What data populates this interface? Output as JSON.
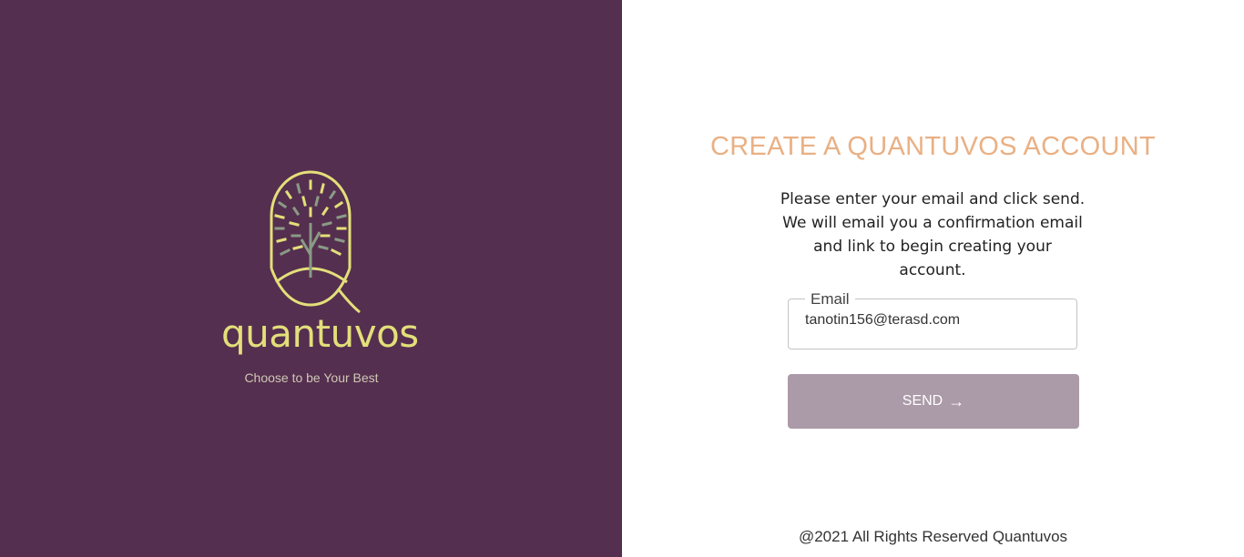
{
  "brand": {
    "name": "quantuvos",
    "tagline": "Choose to be Your Best",
    "colors": {
      "panel_bg": "#552f4f",
      "logo": "#e3df7a",
      "trunk": "#8a9a86"
    }
  },
  "form": {
    "title": "CREATE A QUANTUVOS ACCOUNT",
    "instructions": "Please enter your email and click send. We will email you a confirmation email and link to begin creating your account.",
    "email": {
      "label": "Email",
      "value": "tanotin156@terasd.com"
    },
    "send_label": "SEND",
    "send_icon": "arrow-right-icon"
  },
  "footer": {
    "text": "@2021 All Rights Reserved Quantuvos"
  }
}
